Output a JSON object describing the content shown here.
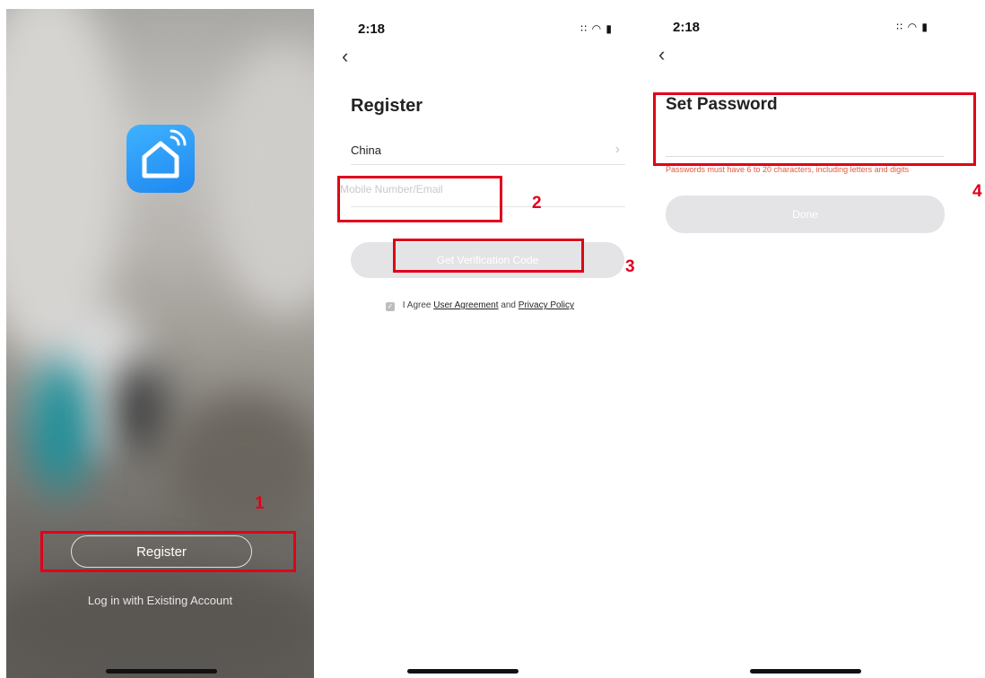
{
  "screen1": {
    "register_label": "Register",
    "login_label": "Log in with Existing Account"
  },
  "screen2": {
    "time": "2:18",
    "status_icons": "∶∶ ◠ ▮",
    "title": "Register",
    "country": "China",
    "phone_placeholder": "Mobile Number/Email",
    "verify_button": "Get Verification Code",
    "agree_prefix": "I Agree",
    "agree_link1": "User Agreement",
    "agree_and": "and",
    "agree_link2": "Privacy Policy"
  },
  "screen3": {
    "time": "2:18",
    "status_icons": "∶∶ ◠ ▮",
    "title": "Set Password",
    "hint": "Passwords must have 6 to 20 characters, including letters and digits",
    "done_button": "Done"
  },
  "annotations": [
    "1",
    "2",
    "3",
    "4"
  ],
  "colors": {
    "annotation": "#e0001b",
    "accent_blue": "#1e88f0",
    "hint_red": "#e8573f"
  }
}
